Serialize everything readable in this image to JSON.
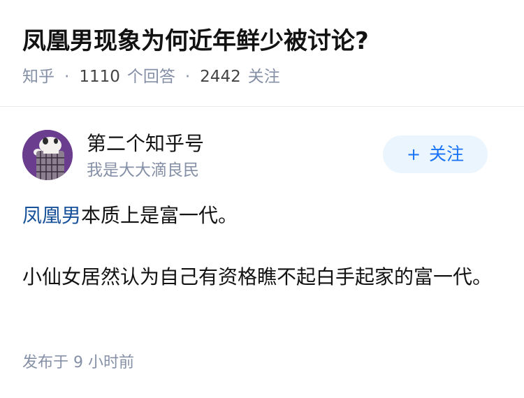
{
  "question": {
    "title": "凤凰男现象为何近年鲜少被讨论?",
    "source": "知乎",
    "separator": "·",
    "answer_count": "1110",
    "answer_label": "个回答",
    "follower_count": "2442",
    "follower_label": "关注"
  },
  "author": {
    "avatar_icon": "avatar-cartoon-icon",
    "name": "第二个知乎号",
    "bio": "我是大大滴良民",
    "follow_plus": "+",
    "follow_label": "关注"
  },
  "answer": {
    "p1_link": "凤凰男",
    "p1_rest": "本质上是富一代。",
    "p2": "小仙女居然认为自己有资格瞧不起白手起家的富一代。"
  },
  "footer": {
    "publish_time": "发布于 9 小时前"
  },
  "colors": {
    "title": "#121212",
    "meta": "#8590a6",
    "link": "#175199",
    "follow_bg": "#ebf5fd",
    "follow_text": "#1772f6",
    "avatar_bg": "#6a3d8f"
  }
}
